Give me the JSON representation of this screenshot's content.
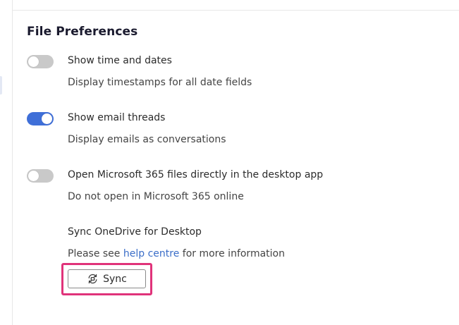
{
  "section": {
    "title": "File Preferences"
  },
  "settings": [
    {
      "label": "Show time and dates",
      "description": "Display timestamps for all date fields",
      "enabled": false
    },
    {
      "label": "Show email threads",
      "description": "Display emails as conversations",
      "enabled": true
    },
    {
      "label": "Open Microsoft 365 files directly in the desktop app",
      "description": "Do not open in Microsoft 365 online",
      "enabled": false
    }
  ],
  "sync": {
    "heading": "Sync OneDrive for Desktop",
    "help_prefix": "Please see ",
    "help_link": "help centre",
    "help_suffix": " for more information",
    "button_label": "Sync",
    "button_icon": "sync-icon"
  },
  "colors": {
    "toggle_on": "#3f6fd8",
    "toggle_off": "#c9c9c9",
    "link": "#3b6ec8",
    "highlight": "#e0337a"
  }
}
